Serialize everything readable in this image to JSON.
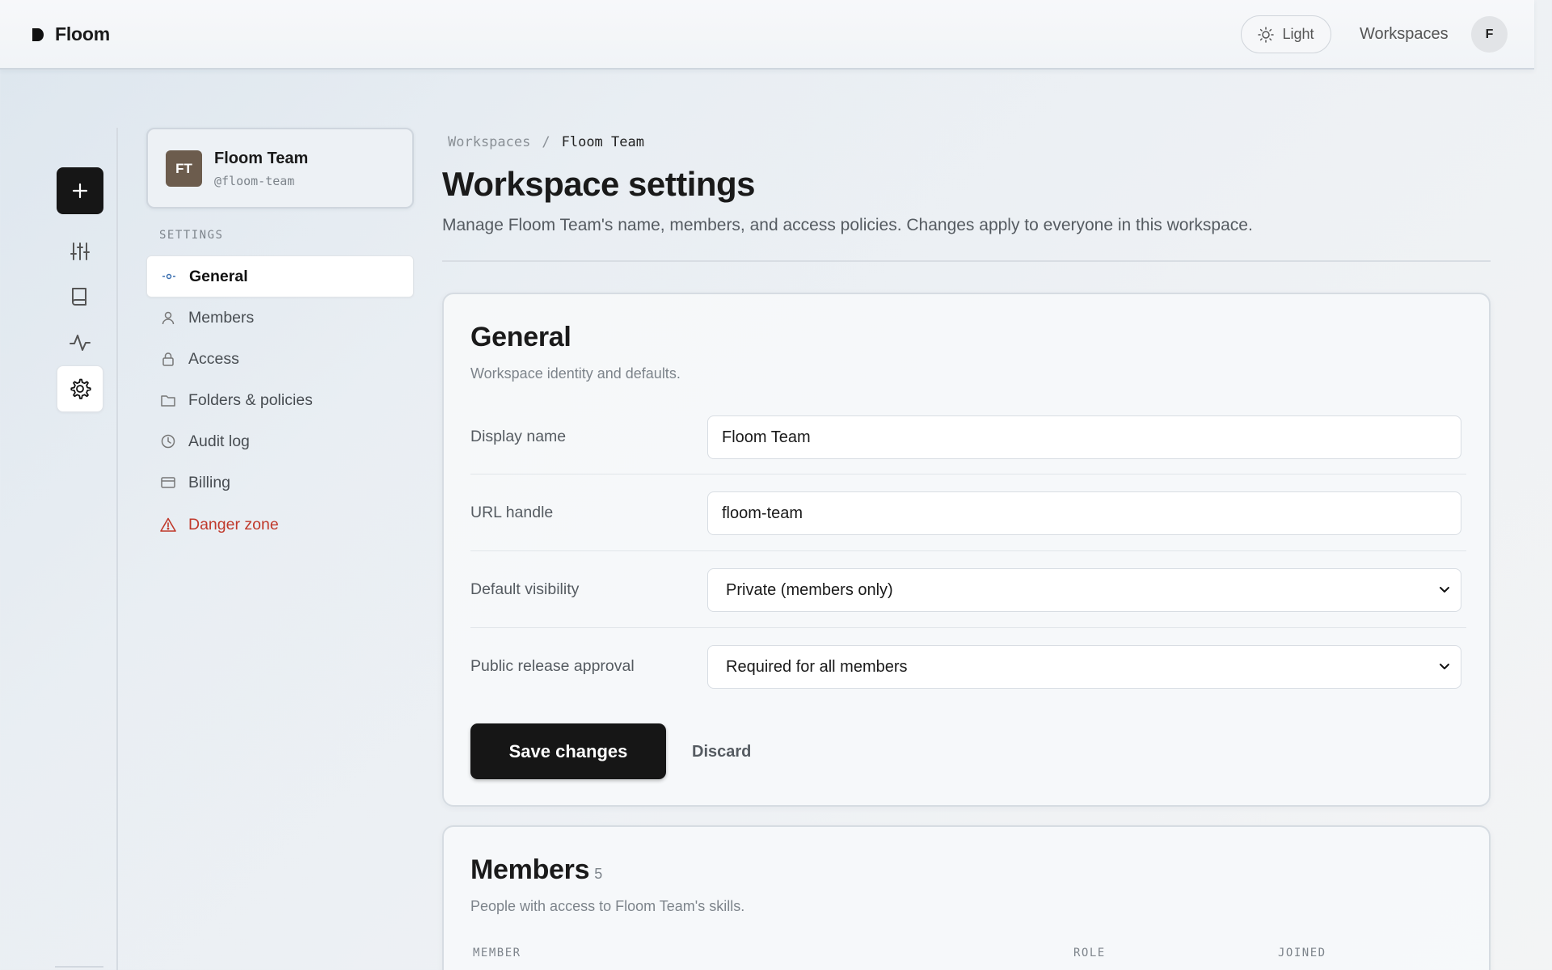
{
  "app": {
    "name": "Floom"
  },
  "topbar": {
    "theme_label": "Light",
    "workspaces_label": "Workspaces",
    "user_initial": "F"
  },
  "rail": {
    "items": [
      "new-icon",
      "sliders-icon",
      "book-icon",
      "activity-icon",
      "gear-icon"
    ]
  },
  "workspace": {
    "initials": "FT",
    "name": "Floom Team",
    "handle": "@floom-team"
  },
  "sidebar": {
    "section_label": "SETTINGS",
    "items": [
      {
        "label": "General",
        "icon": "general-icon",
        "active": true
      },
      {
        "label": "Members",
        "icon": "user-icon"
      },
      {
        "label": "Access",
        "icon": "lock-icon"
      },
      {
        "label": "Folders & policies",
        "icon": "folder-icon"
      },
      {
        "label": "Audit log",
        "icon": "clock-icon"
      },
      {
        "label": "Billing",
        "icon": "card-icon"
      },
      {
        "label": "Danger zone",
        "icon": "warning-icon",
        "color": "#c0392b"
      }
    ]
  },
  "breadcrumb": {
    "root": "Workspaces",
    "separator": "/",
    "current": "Floom Team"
  },
  "page": {
    "title": "Workspace settings",
    "subtitle": "Manage Floom Team's name, members, and access policies. Changes apply to everyone in this workspace."
  },
  "general": {
    "title": "General",
    "subtitle": "Workspace identity and defaults.",
    "fields": [
      {
        "label": "Display name",
        "value": "Floom Team"
      },
      {
        "label": "URL handle",
        "value": "floom-team"
      },
      {
        "label": "Default visibility",
        "value": "Private (members only)"
      },
      {
        "label": "Public release approval",
        "value": "Required for all members"
      }
    ],
    "save_label": "Save changes",
    "discard_label": "Discard"
  },
  "members": {
    "title": "Members",
    "count": "5",
    "subtitle": "People with access to Floom Team's skills.",
    "columns": [
      "MEMBER",
      "ROLE",
      "JOINED"
    ]
  },
  "colors": {
    "accent": "#161616",
    "danger": "#c0392b",
    "avatar": "#6c5c4d"
  }
}
